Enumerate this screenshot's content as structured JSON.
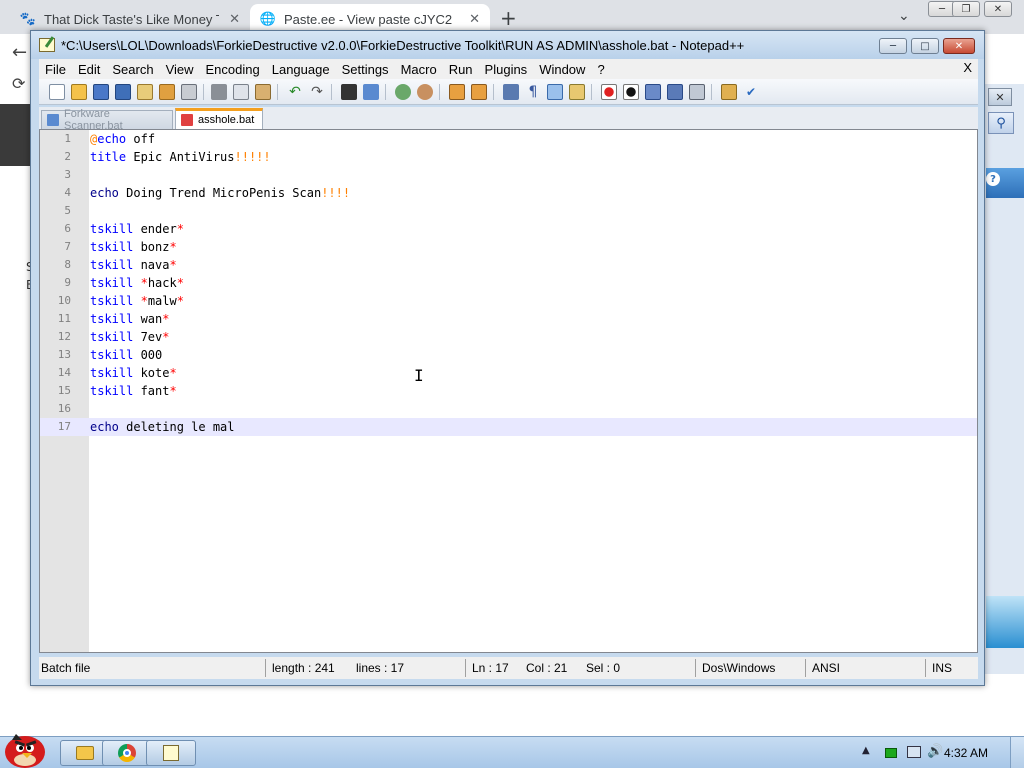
{
  "browser": {
    "tabs": [
      {
        "title": "That Dick Taste's Like Money T",
        "close": "✕"
      },
      {
        "title": "Paste.ee - View paste cJYC2",
        "close": "✕"
      }
    ],
    "new_tab": "+",
    "dropdown": "⌄",
    "side_text_1": "S",
    "side_text_2": "E"
  },
  "bg_window": {
    "close": "✕",
    "search_icon": "⚲",
    "help": "?"
  },
  "notepad": {
    "title": "*C:\\Users\\LOL\\Downloads\\ForkieDestructive v2.0.0\\ForkieDestructive Toolkit\\RUN AS ADMIN\\asshole.bat - Notepad++",
    "window_buttons": {
      "minimize": "─",
      "maximize": "□",
      "close": "✕"
    },
    "menu": [
      "File",
      "Edit",
      "Search",
      "View",
      "Encoding",
      "Language",
      "Settings",
      "Macro",
      "Run",
      "Plugins",
      "Window",
      "?"
    ],
    "menu_close": "X",
    "tabs": [
      {
        "label": "Forkware Scanner.bat",
        "active": false
      },
      {
        "label": "asshole.bat",
        "active": true
      }
    ],
    "lines": [
      {
        "num": "1",
        "tokens": [
          {
            "t": "@",
            "c": "op"
          },
          {
            "t": "echo",
            "c": "kw"
          },
          {
            "t": " off",
            "c": "txt"
          }
        ]
      },
      {
        "num": "2",
        "tokens": [
          {
            "t": "title",
            "c": "kw"
          },
          {
            "t": " Epic AntiVirus",
            "c": "txt"
          },
          {
            "t": "!!!!!",
            "c": "op"
          }
        ]
      },
      {
        "num": "3",
        "tokens": []
      },
      {
        "num": "4",
        "tokens": [
          {
            "t": "echo",
            "c": "kwd"
          },
          {
            "t": " Doing Trend MicroPenis Scan",
            "c": "txt"
          },
          {
            "t": "!!!!",
            "c": "op"
          }
        ]
      },
      {
        "num": "5",
        "tokens": []
      },
      {
        "num": "6",
        "tokens": [
          {
            "t": "tskill",
            "c": "kw"
          },
          {
            "t": " ender",
            "c": "txt"
          },
          {
            "t": "*",
            "c": "red"
          }
        ]
      },
      {
        "num": "7",
        "tokens": [
          {
            "t": "tskill",
            "c": "kw"
          },
          {
            "t": " bonz",
            "c": "txt"
          },
          {
            "t": "*",
            "c": "red"
          }
        ]
      },
      {
        "num": "8",
        "tokens": [
          {
            "t": "tskill",
            "c": "kw"
          },
          {
            "t": " nava",
            "c": "txt"
          },
          {
            "t": "*",
            "c": "red"
          }
        ]
      },
      {
        "num": "9",
        "tokens": [
          {
            "t": "tskill",
            "c": "kw"
          },
          {
            "t": " ",
            "c": "txt"
          },
          {
            "t": "*",
            "c": "red"
          },
          {
            "t": "hack",
            "c": "txt"
          },
          {
            "t": "*",
            "c": "red"
          }
        ]
      },
      {
        "num": "10",
        "tokens": [
          {
            "t": "tskill",
            "c": "kw"
          },
          {
            "t": " ",
            "c": "txt"
          },
          {
            "t": "*",
            "c": "red"
          },
          {
            "t": "malw",
            "c": "txt"
          },
          {
            "t": "*",
            "c": "red"
          }
        ]
      },
      {
        "num": "11",
        "tokens": [
          {
            "t": "tskill",
            "c": "kw"
          },
          {
            "t": " wan",
            "c": "txt"
          },
          {
            "t": "*",
            "c": "red"
          }
        ]
      },
      {
        "num": "12",
        "tokens": [
          {
            "t": "tskill",
            "c": "kw"
          },
          {
            "t": " 7ev",
            "c": "txt"
          },
          {
            "t": "*",
            "c": "red"
          }
        ]
      },
      {
        "num": "13",
        "tokens": [
          {
            "t": "tskill",
            "c": "kw"
          },
          {
            "t": " 000",
            "c": "txt"
          }
        ]
      },
      {
        "num": "14",
        "tokens": [
          {
            "t": "tskill",
            "c": "kw"
          },
          {
            "t": " kote",
            "c": "txt"
          },
          {
            "t": "*",
            "c": "red"
          }
        ]
      },
      {
        "num": "15",
        "tokens": [
          {
            "t": "tskill",
            "c": "kw"
          },
          {
            "t": " fant",
            "c": "txt"
          },
          {
            "t": "*",
            "c": "red"
          }
        ]
      },
      {
        "num": "16",
        "tokens": []
      },
      {
        "num": "17",
        "tokens": [
          {
            "t": "echo",
            "c": "kwd"
          },
          {
            "t": " deleting le mal",
            "c": "txt"
          }
        ],
        "current": true
      }
    ],
    "cursor_glyph": "I",
    "status": {
      "type": "Batch file",
      "length": "length : 241",
      "lines": "lines : 17",
      "ln": "Ln : 17",
      "col": "Col : 21",
      "sel": "Sel : 0",
      "eol": "Dos\\Windows",
      "encoding": "ANSI",
      "mode": "INS"
    }
  },
  "taskbar": {
    "clock": "4:32 AM",
    "tray_up": "▲",
    "volume_icon": "🔊"
  }
}
